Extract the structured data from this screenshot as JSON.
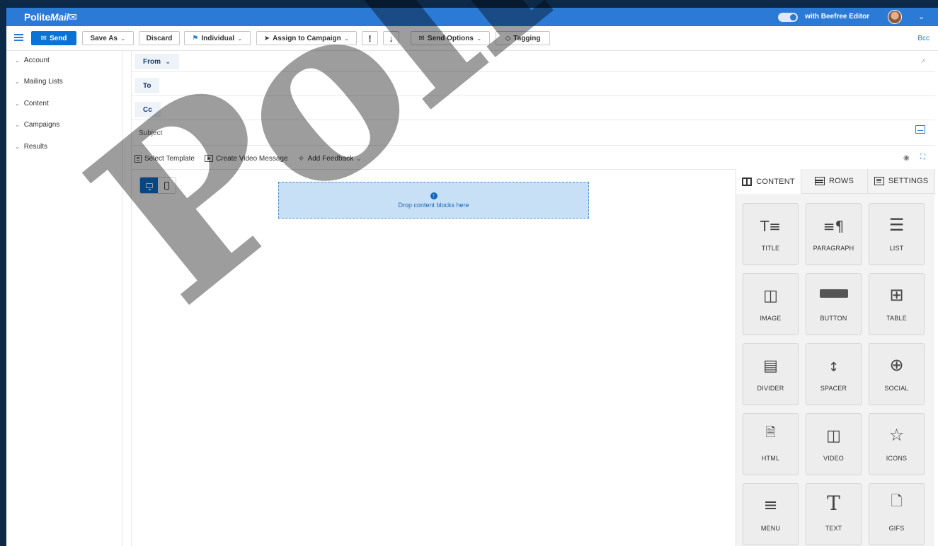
{
  "header": {
    "logo_prefix": "Polite",
    "logo_suffix": "Mail",
    "editor_toggle_label": "with Beefree Editor"
  },
  "toolbar": {
    "send": "Send",
    "save_as": "Save As",
    "discard": "Discard",
    "individual": "Individual",
    "assign_campaign": "Assign to Campaign",
    "importance": "!",
    "low_priority": "↓",
    "send_options": "Send Options",
    "tagging": "Tagging",
    "bcc": "Bcc"
  },
  "sidebar": {
    "items": [
      {
        "label": "Account"
      },
      {
        "label": "Mailing Lists"
      },
      {
        "label": "Content"
      },
      {
        "label": "Campaigns"
      },
      {
        "label": "Results"
      }
    ]
  },
  "compose": {
    "from_label": "From",
    "to_label": "To",
    "cc_label": "Cc",
    "subject_placeholder": "Subject"
  },
  "actions": {
    "select_template": "Select Template",
    "create_video": "Create Video Message",
    "add_feedback": "Add Feedback"
  },
  "canvas": {
    "drop_text": "Drop content blocks here"
  },
  "panel": {
    "tabs": [
      {
        "label": "CONTENT"
      },
      {
        "label": "ROWS"
      },
      {
        "label": "SETTINGS"
      }
    ],
    "blocks": [
      {
        "label": "TITLE",
        "icon": "title-icon"
      },
      {
        "label": "PARAGRAPH",
        "icon": "paragraph-icon"
      },
      {
        "label": "LIST",
        "icon": "list-icon"
      },
      {
        "label": "IMAGE",
        "icon": "image-icon"
      },
      {
        "label": "BUTTON",
        "icon": "button-icon"
      },
      {
        "label": "TABLE",
        "icon": "table-icon"
      },
      {
        "label": "DIVIDER",
        "icon": "divider-icon"
      },
      {
        "label": "SPACER",
        "icon": "spacer-icon"
      },
      {
        "label": "SOCIAL",
        "icon": "social-icon"
      },
      {
        "label": "HTML",
        "icon": "html-icon"
      },
      {
        "label": "VIDEO",
        "icon": "video-icon"
      },
      {
        "label": "ICONS",
        "icon": "star-icon"
      },
      {
        "label": "MENU",
        "icon": "menu-icon"
      },
      {
        "label": "TEXT",
        "icon": "text-icon"
      },
      {
        "label": "GIFS",
        "icon": "gif-icon"
      }
    ]
  },
  "watermark": {
    "text": "PoliteMail"
  },
  "colors": {
    "brand": "#2b7bd6",
    "send_button": "#0b73d6",
    "dropzone": "#c8e0f6"
  }
}
